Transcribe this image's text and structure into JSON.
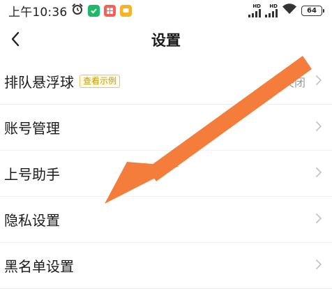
{
  "status_bar": {
    "time": "上午10:36",
    "signal_label_1": "HD",
    "signal_label_2": "HD",
    "battery": "64"
  },
  "header": {
    "title": "设置"
  },
  "settings": {
    "items": [
      {
        "label": "排队悬浮球",
        "tag": "查看示例",
        "value": "关闭"
      },
      {
        "label": "账号管理"
      },
      {
        "label": "上号助手"
      },
      {
        "label": "隐私设置"
      },
      {
        "label": "黑名单设置"
      }
    ]
  },
  "colors": {
    "tag_text": "#c99a00",
    "tag_border": "#e9c65a",
    "arrow": "#f47d3c",
    "secondary_text": "#9a9a9a"
  },
  "icons": {
    "back": "chevron-left-icon",
    "row_arrow": "chevron-right-icon",
    "alarm": "alarm-clock-icon",
    "wifi": "wifi-icon"
  }
}
